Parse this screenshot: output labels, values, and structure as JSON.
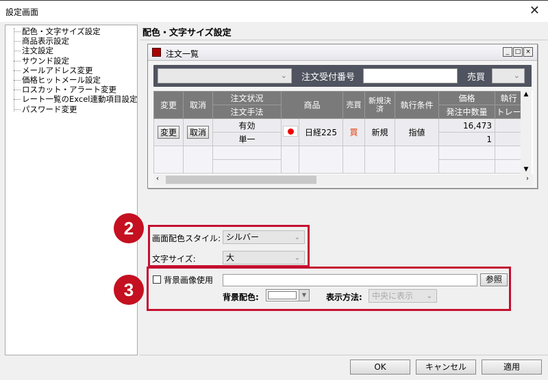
{
  "window": {
    "title": "設定画面",
    "close_icon": "✕"
  },
  "tree": {
    "items": [
      "配色・文字サイズ設定",
      "商品表示設定",
      "注文設定",
      "サウンド設定",
      "メールアドレス変更",
      "価格ヒットメール設定",
      "ロスカット・アラート変更",
      "レート一覧のExcel連動項目設定",
      "パスワード変更"
    ]
  },
  "section": {
    "title": "配色・文字サイズ設定"
  },
  "preview": {
    "title": "注文一覧",
    "win_buttons": [
      "_",
      "□",
      "×"
    ],
    "filter": {
      "order_no_label": "注文受付番号",
      "order_no_value": "",
      "buysell_label": "売買",
      "first_select_value": "",
      "buysell_value": ""
    },
    "headers": {
      "change": "変更",
      "cancel": "取消",
      "status": "注文状況",
      "method": "注文手法",
      "product": "商品",
      "buysell": "売買",
      "newclose": "新規決済",
      "condition": "執行条件",
      "price": "価格",
      "qty": "発注中数量",
      "exec": "執行",
      "trail": "トレー"
    },
    "row": {
      "change_btn": "変更",
      "cancel_btn": "取消",
      "status": "有効",
      "method": "単一",
      "product": "日経225",
      "buysell": "買",
      "newclose": "新規",
      "condition": "指値",
      "price": "16,473",
      "qty": "1"
    },
    "colors": {
      "buy": "#e04010",
      "header_bg": "#7a7a7a"
    }
  },
  "badges": {
    "two": "2",
    "three": "3",
    "color": "#c41020"
  },
  "settings": {
    "style_label": "画面配色スタイル:",
    "style_value": "シルバー",
    "size_label": "文字サイズ:",
    "size_value": "大",
    "bg_image_label": "背景画像使用",
    "bg_image_checked": false,
    "bg_image_path": "",
    "browse_label": "参照",
    "bg_color_label": "背景配色:",
    "display_label": "表示方法:",
    "display_value": "中央に表示"
  },
  "footer": {
    "ok": "OK",
    "cancel": "キャンセル",
    "apply": "適用"
  }
}
